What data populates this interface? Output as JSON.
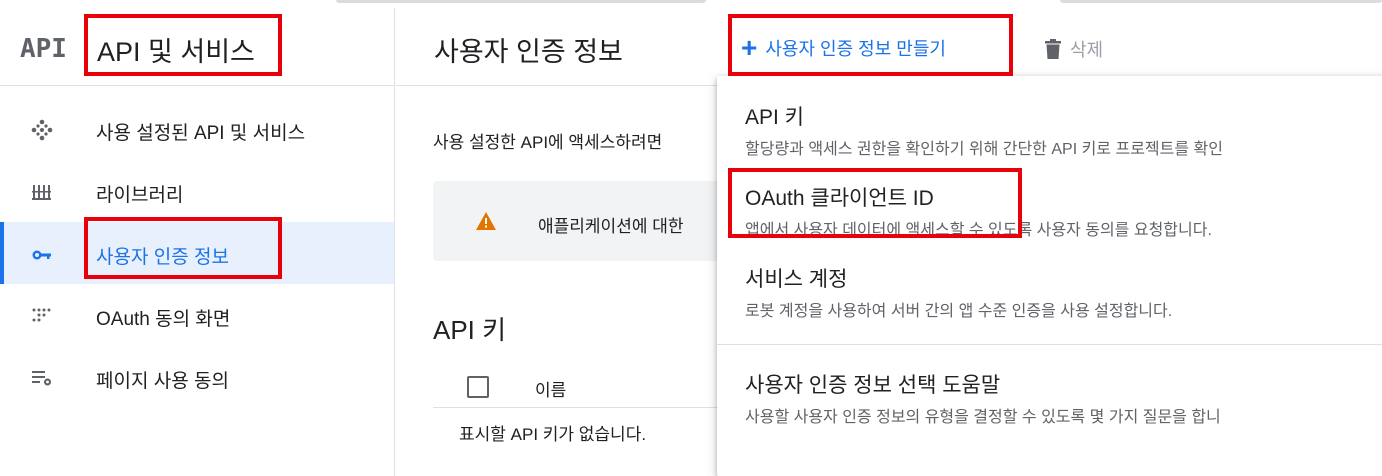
{
  "sidebar": {
    "logo": "API",
    "title": "API 및 서비스",
    "items": [
      {
        "label": "사용 설정된 API 및 서비스",
        "icon": "diamond-dots-icon",
        "active": false
      },
      {
        "label": "라이브러리",
        "icon": "library-icon",
        "active": false
      },
      {
        "label": "사용자 인증 정보",
        "icon": "key-icon",
        "active": true
      },
      {
        "label": "OAuth 동의 화면",
        "icon": "consent-dots-icon",
        "active": false
      },
      {
        "label": "페이지 사용 동의",
        "icon": "list-settings-icon",
        "active": false
      }
    ]
  },
  "header": {
    "title": "사용자 인증 정보",
    "create_label": "사용자 인증 정보 만들기",
    "delete_label": "삭제"
  },
  "main": {
    "intro": "사용 설정한 API에 액세스하려면",
    "warning": "애플리케이션에 대한",
    "section_title": "API 키",
    "column_name": "이름",
    "empty_text": "표시할 API 키가 없습니다."
  },
  "menu": {
    "items": [
      {
        "title": "API 키",
        "desc": "할당량과 액세스 권한을 확인하기 위해 간단한 API 키로 프로젝트를 확인"
      },
      {
        "title": "OAuth 클라이언트 ID",
        "desc": "앱에서 사용자 데이터에 액세스할 수 있도록 사용자 동의를 요청합니다."
      },
      {
        "title": "서비스 계정",
        "desc": "로봇 계정을 사용하여 서버 간의 앱 수준 인증을 사용 설정합니다."
      },
      {
        "title": "사용자 인증 정보 선택 도움말",
        "desc": "사용할 사용자 인증 정보의 유형을 결정할 수 있도록 몇 가지 질문을 합니"
      }
    ]
  },
  "colors": {
    "accent": "#1a73e8",
    "highlight_box": "#e8000b",
    "warning": "#e37400",
    "active_bg": "#e8f0fe"
  }
}
